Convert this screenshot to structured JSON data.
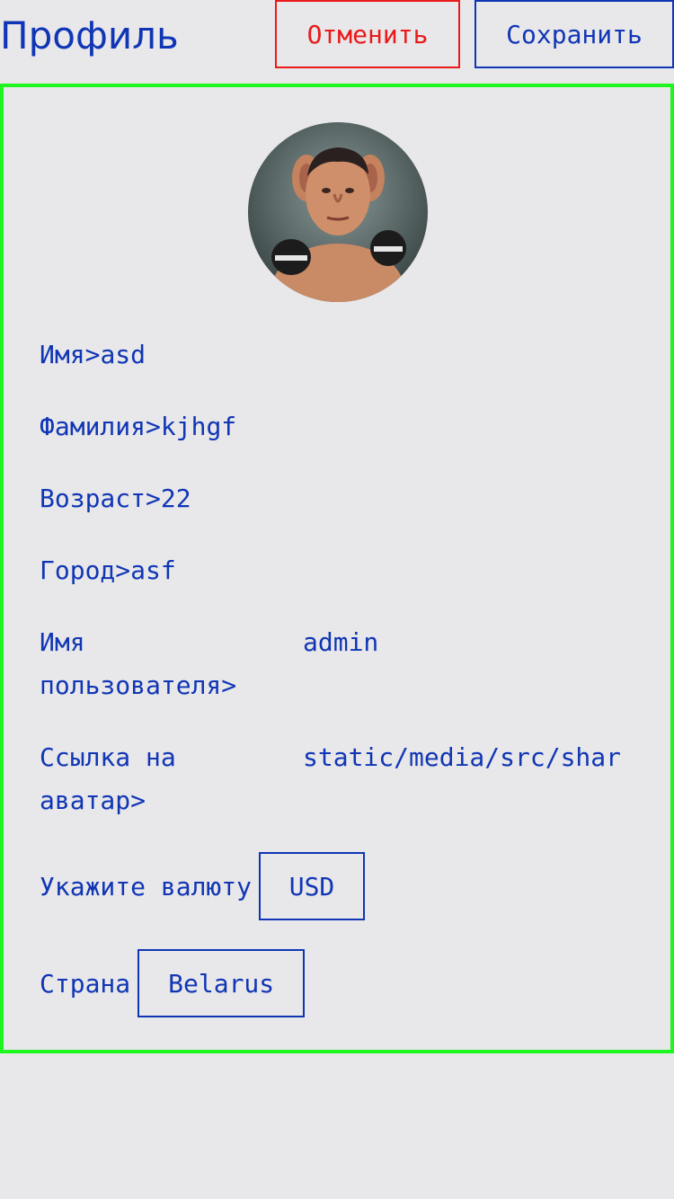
{
  "header": {
    "title": "Профиль",
    "cancel_label": "Отменить",
    "save_label": "Сохранить"
  },
  "profile": {
    "avatar_icon": "user-avatar-photo",
    "first_name": {
      "label": "Имя",
      "separator": ">",
      "value": "asd"
    },
    "last_name": {
      "label": "Фамилия",
      "separator": ">",
      "value": "kjhgf"
    },
    "age": {
      "label": "Возраст",
      "separator": ">",
      "value": "22"
    },
    "city": {
      "label": "Город",
      "separator": ">",
      "value": "asf"
    },
    "username": {
      "label": "Имя пользователя>",
      "value": "admin"
    },
    "avatar_link": {
      "label": "Ссылка на аватар>",
      "value": "static/media/src/shar"
    },
    "currency": {
      "label": "Укажите валюту",
      "value": "USD"
    },
    "country": {
      "label": "Страна",
      "value": "Belarus"
    }
  },
  "colors": {
    "primary": "#1036b5",
    "cancel": "#ea1a1a",
    "card_border": "#1ff51f",
    "background": "#e8e7ea"
  }
}
